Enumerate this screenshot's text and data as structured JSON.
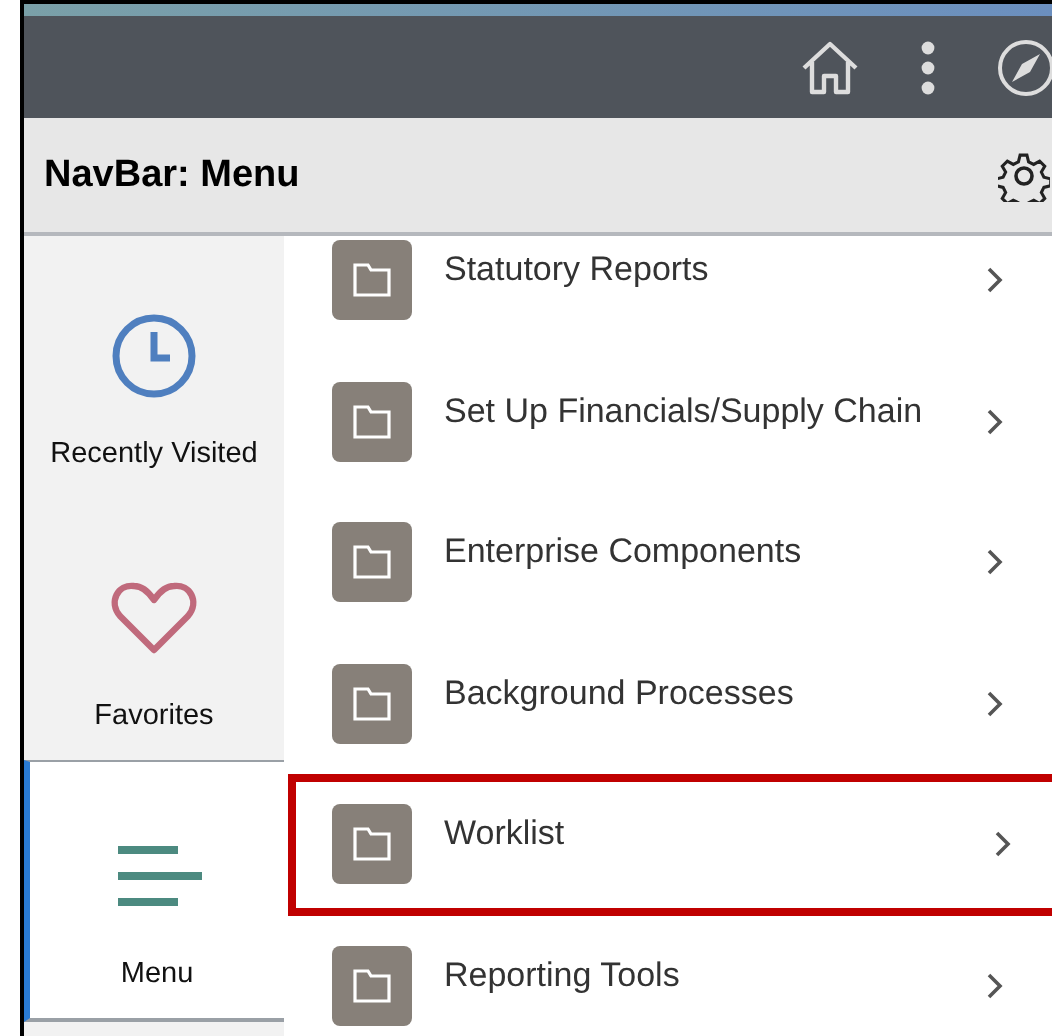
{
  "title": "NavBar: Menu",
  "sidebar": {
    "items": [
      {
        "label": "Recently Visited",
        "kind": "clock",
        "selected": false
      },
      {
        "label": "Favorites",
        "kind": "heart",
        "selected": false
      },
      {
        "label": "Menu",
        "kind": "menu",
        "selected": true
      }
    ]
  },
  "menu": {
    "items": [
      {
        "label": "Statutory Reports",
        "highlighted": false
      },
      {
        "label": "Set Up Financials/Supply Chain",
        "highlighted": false
      },
      {
        "label": "Enterprise Components",
        "highlighted": false
      },
      {
        "label": "Background Processes",
        "highlighted": false
      },
      {
        "label": "Worklist",
        "highlighted": true
      },
      {
        "label": "Reporting Tools",
        "highlighted": false
      }
    ]
  }
}
